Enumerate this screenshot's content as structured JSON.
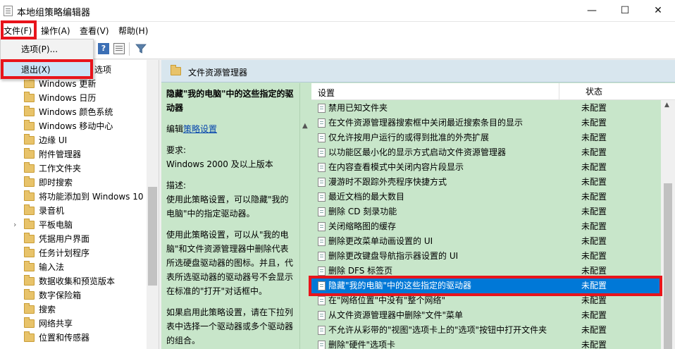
{
  "window": {
    "title": "本地组策略编辑器",
    "min_glyph": "—",
    "max_glyph": "☐",
    "close_glyph": "✕"
  },
  "menu": {
    "file": "文件(F)",
    "action": "操作(A)",
    "view": "查看(V)",
    "help": "帮助(H)"
  },
  "file_menu": {
    "options": "选项(P)...",
    "exit": "退出(X)"
  },
  "toolbar": {
    "help_glyph": "?",
    "filter_icon": "filter-icon"
  },
  "tree": {
    "partial_item": "选项",
    "items": [
      {
        "label": "Windows 更新",
        "expandable": false
      },
      {
        "label": "Windows 日历",
        "expandable": false
      },
      {
        "label": "Windows 颜色系统",
        "expandable": false
      },
      {
        "label": "Windows 移动中心",
        "expandable": false
      },
      {
        "label": "边缘 UI",
        "expandable": false
      },
      {
        "label": "附件管理器",
        "expandable": false
      },
      {
        "label": "工作文件夹",
        "expandable": false
      },
      {
        "label": "即时搜索",
        "expandable": false
      },
      {
        "label": "将功能添加到 Windows 10",
        "expandable": false
      },
      {
        "label": "录音机",
        "expandable": false
      },
      {
        "label": "平板电脑",
        "expandable": true
      },
      {
        "label": "凭据用户界面",
        "expandable": false
      },
      {
        "label": "任务计划程序",
        "expandable": false
      },
      {
        "label": "输入法",
        "expandable": false
      },
      {
        "label": "数据收集和预览版本",
        "expandable": false
      },
      {
        "label": "数字保险箱",
        "expandable": false
      },
      {
        "label": "搜索",
        "expandable": false
      },
      {
        "label": "网络共享",
        "expandable": false
      },
      {
        "label": "位置和传感器",
        "expandable": false
      }
    ]
  },
  "right": {
    "header_title": "文件资源管理器",
    "desc": {
      "title": "隐藏\"我的电脑\"中的这些指定的驱动器",
      "edit_prefix": "编辑",
      "edit_link": "策略设置",
      "req_label": "要求:",
      "req_value": "Windows 2000 及以上版本",
      "desc_label": "描述:",
      "para1": "使用此策略设置，可以隐藏\"我的电脑\"中的指定驱动器。",
      "para2": "使用此策略设置，可以从\"我的电脑\"和文件资源管理器中删除代表所选硬盘驱动器的图标。并且，代表所选驱动器的驱动器号不会显示在标准的\"打开\"对话框中。",
      "para3": "如果启用此策略设置，请在下拉列表中选择一个驱动器或多个驱动器的组合。"
    },
    "columns": {
      "setting": "设置",
      "state": "状态"
    },
    "policies": [
      {
        "name": "禁用已知文件夹",
        "state": "未配置",
        "selected": false
      },
      {
        "name": "在文件资源管理器搜索框中关闭最近搜索条目的显示",
        "state": "未配置",
        "selected": false
      },
      {
        "name": "仅允许按用户运行的或得到批准的外壳扩展",
        "state": "未配置",
        "selected": false
      },
      {
        "name": "以功能区最小化的显示方式启动文件资源管理器",
        "state": "未配置",
        "selected": false
      },
      {
        "name": "在内容查看模式中关闭内容片段显示",
        "state": "未配置",
        "selected": false
      },
      {
        "name": "漫游时不跟踪外壳程序快捷方式",
        "state": "未配置",
        "selected": false
      },
      {
        "name": "最近文档的最大数目",
        "state": "未配置",
        "selected": false
      },
      {
        "name": "删除 CD 刻录功能",
        "state": "未配置",
        "selected": false
      },
      {
        "name": "关闭缩略图的缓存",
        "state": "未配置",
        "selected": false
      },
      {
        "name": "删除更改菜单动画设置的 UI",
        "state": "未配置",
        "selected": false
      },
      {
        "name": "删除更改键盘导航指示器设置的 UI",
        "state": "未配置",
        "selected": false
      },
      {
        "name": "删除 DFS 标签页",
        "state": "未配置",
        "selected": false
      },
      {
        "name": "隐藏\"我的电脑\"中的这些指定的驱动器",
        "state": "未配置",
        "selected": true
      },
      {
        "name": "在\"网络位置\"中没有\"整个网络\"",
        "state": "未配置",
        "selected": false
      },
      {
        "name": "从文件资源管理器中删除\"文件\"菜单",
        "state": "未配置",
        "selected": false
      },
      {
        "name": "不允许从彩带的\"视图\"选项卡上的\"选项\"按钮中打开文件夹",
        "state": "未配置",
        "selected": false
      },
      {
        "name": "删除\"硬件\"选项卡",
        "state": "未配置",
        "selected": false
      }
    ]
  },
  "colors": {
    "highlight_red": "#e8141b",
    "selection_blue": "#0078d7",
    "pane_green": "#c8e6ca"
  }
}
